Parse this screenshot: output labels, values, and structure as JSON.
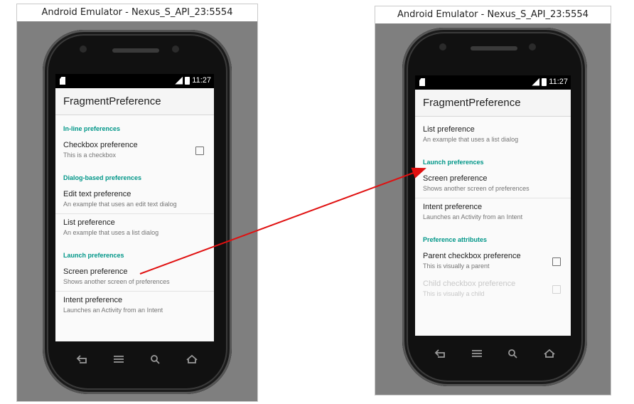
{
  "left": {
    "window_title": "Android Emulator - Nexus_S_API_23:5554",
    "status_time": "11:27",
    "app_title": "FragmentPreference",
    "items": [
      {
        "kind": "category",
        "text": "In-line preferences"
      },
      {
        "kind": "pref",
        "title": "Checkbox preference",
        "summary": "This is a checkbox",
        "checkbox": true
      },
      {
        "kind": "category",
        "text": "Dialog-based preferences"
      },
      {
        "kind": "pref",
        "title": "Edit text preference",
        "summary": "An example that uses an edit text dialog",
        "divider": true
      },
      {
        "kind": "pref",
        "title": "List preference",
        "summary": "An example that uses a list dialog"
      },
      {
        "kind": "category",
        "text": "Launch preferences"
      },
      {
        "kind": "pref",
        "title": "Screen preference",
        "summary": "Shows another screen of preferences",
        "divider": true
      },
      {
        "kind": "pref",
        "title": "Intent preference",
        "summary": "Launches an Activity from an Intent"
      }
    ]
  },
  "right": {
    "window_title": "Android Emulator - Nexus_S_API_23:5554",
    "status_time": "11:27",
    "app_title": "FragmentPreference",
    "items": [
      {
        "kind": "pref",
        "title": "List preference",
        "summary": "An example that uses a list dialog"
      },
      {
        "kind": "category",
        "text": "Launch preferences"
      },
      {
        "kind": "pref",
        "title": "Screen preference",
        "summary": "Shows another screen of preferences",
        "divider": true
      },
      {
        "kind": "pref",
        "title": "Intent preference",
        "summary": "Launches an Activity from an Intent"
      },
      {
        "kind": "category",
        "text": "Preference attributes"
      },
      {
        "kind": "pref",
        "title": "Parent checkbox preference",
        "summary": "This is visually a parent",
        "checkbox": true
      },
      {
        "kind": "pref",
        "title": "Child checkbox preference",
        "summary": "This is visually a child",
        "checkbox": true,
        "disabled": true
      }
    ]
  },
  "icons": {
    "back": "back-icon",
    "home": "home-icon",
    "search": "search-icon",
    "menu": "menu-icon"
  },
  "colors": {
    "accent": "#009688",
    "arrow": "#e01010",
    "emulator_bg": "#7f7f7f"
  }
}
